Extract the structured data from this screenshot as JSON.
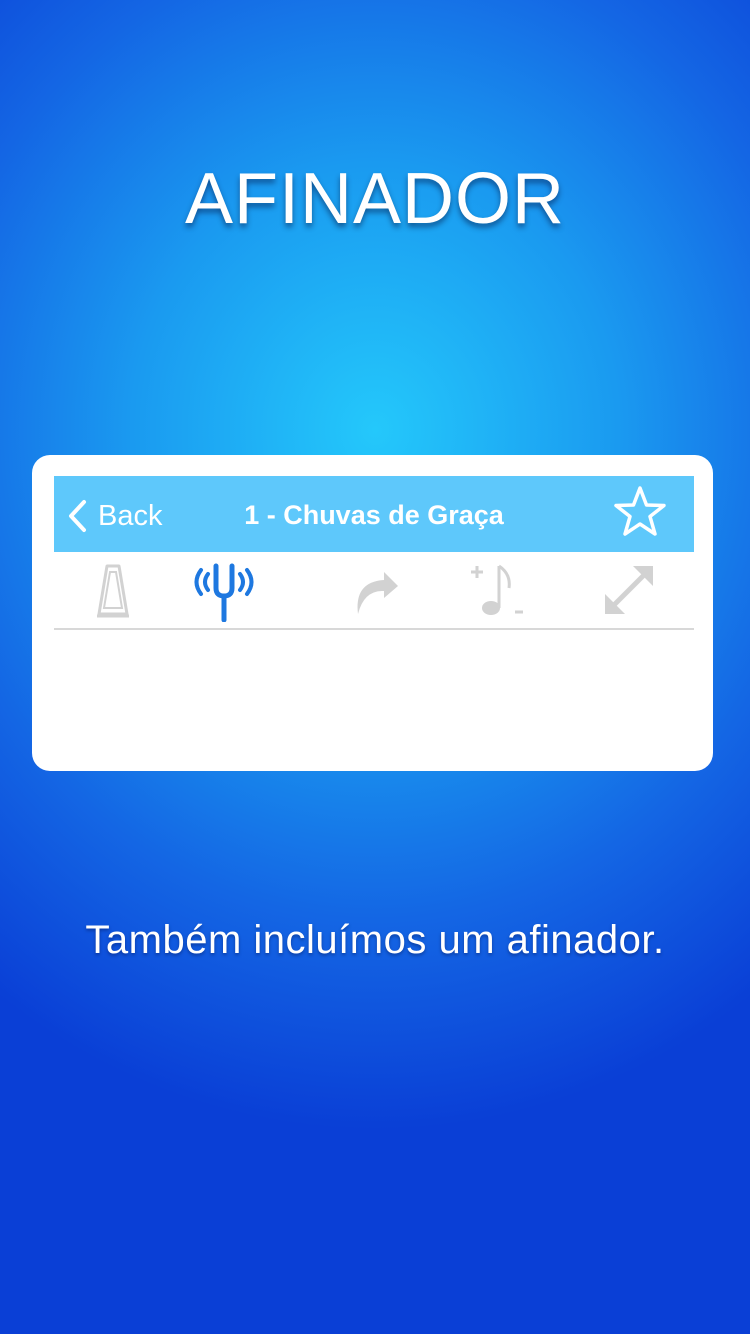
{
  "headline": "AFINADOR",
  "navbar": {
    "back_label": "Back",
    "title": "1 - Chuvas de Graça",
    "back_icon": "chevron-left-icon",
    "favorite_icon": "star-outline-icon"
  },
  "toolbar": {
    "items": [
      {
        "icon": "metronome-icon",
        "active": false
      },
      {
        "icon": "tuning-fork-icon",
        "active": true
      },
      {
        "icon": "share-arrow-icon",
        "active": false
      },
      {
        "icon": "transpose-note-icon",
        "active": false
      },
      {
        "icon": "fullscreen-expand-icon",
        "active": false
      }
    ]
  },
  "caption": "Também incluímos um afinador.",
  "colors": {
    "navbar": "#5ec8fb",
    "active_icon": "#1e78e0",
    "inactive_icon": "#d2d2d2",
    "background_center": "#24c8fb",
    "background_edge": "#0a3fd6"
  }
}
